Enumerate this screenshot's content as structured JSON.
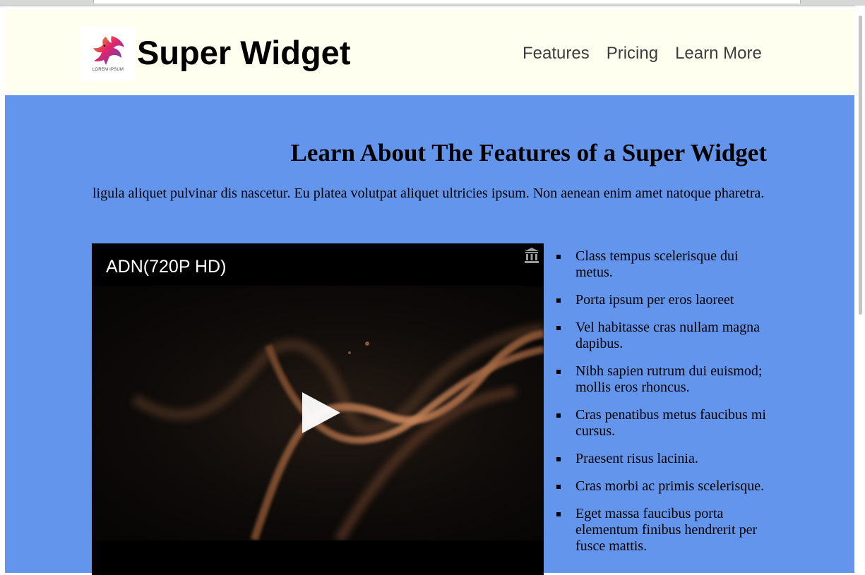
{
  "header": {
    "logo_caption": "LOREM IPSUM",
    "title": "Super Widget",
    "nav": [
      {
        "label": "Features"
      },
      {
        "label": "Pricing"
      },
      {
        "label": "Learn More"
      }
    ]
  },
  "main": {
    "heading": "Learn About The Features of a Super Widget",
    "paragraph": "ligula aliquet pulvinar dis nascetur. Eu platea volutpat aliquet ultricies ipsum. Non aenean enim amet natoque pharetra.",
    "video": {
      "title": "ADN(720P HD)",
      "library_icon": "library-icon",
      "play_icon": "play-icon"
    },
    "features": [
      "Class tempus scelerisque dui metus.",
      "Porta ipsum per eros laoreet",
      "Vel habitasse cras nullam magna dapibus.",
      "Nibh sapien rutrum dui euismod; mollis eros rhoncus.",
      "Cras penatibus metus faucibus mi cursus.",
      "Praesent risus lacinia.",
      "Cras morbi ac primis scelerisque.",
      "Eget massa faucibus porta elementum finibus hendrerit per fusce mattis."
    ]
  },
  "colors": {
    "header_bg": "#fffff0",
    "main_bg": "#6495ed",
    "video_bg": "#000000"
  }
}
